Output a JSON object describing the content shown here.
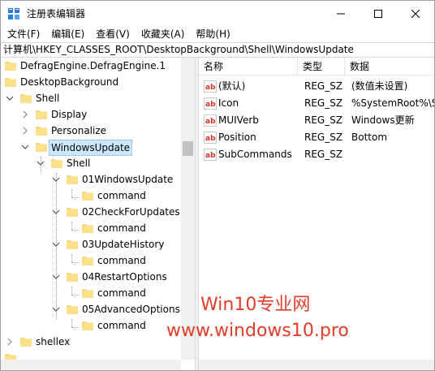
{
  "window": {
    "title": "注册表编辑器",
    "icon": "regedit-icon"
  },
  "menu": [
    "文件(F)",
    "编辑(E)",
    "查看(V)",
    "收藏夹(A)",
    "帮助(H)"
  ],
  "address": "计算机\\HKEY_CLASSES_ROOT\\DesktopBackground\\Shell\\WindowsUpdate",
  "tree": [
    {
      "label": "DefragEngine.DefragEngine.1"
    },
    {
      "label": "DesktopBackground"
    },
    {
      "label": "Shell"
    },
    {
      "label": "Display"
    },
    {
      "label": "Personalize"
    },
    {
      "label": "WindowsUpdate",
      "selected": true
    },
    {
      "label": "Shell"
    },
    {
      "label": "01WindowsUpdate"
    },
    {
      "label": "command"
    },
    {
      "label": "02CheckForUpdates"
    },
    {
      "label": "command"
    },
    {
      "label": "03UpdateHistory"
    },
    {
      "label": "command"
    },
    {
      "label": "04RestartOptions"
    },
    {
      "label": "command"
    },
    {
      "label": "05AdvancedOptions"
    },
    {
      "label": "command"
    },
    {
      "label": "shellex"
    }
  ],
  "list": {
    "columns": [
      "名称",
      "类型",
      "数据"
    ],
    "rows": [
      {
        "name": "(默认)",
        "type": "REG_SZ",
        "data": "(数值未设置)"
      },
      {
        "name": "Icon",
        "type": "REG_SZ",
        "data": "%SystemRoot%\\S"
      },
      {
        "name": "MUIVerb",
        "type": "REG_SZ",
        "data": "Windows更新"
      },
      {
        "name": "Position",
        "type": "REG_SZ",
        "data": "Bottom"
      },
      {
        "name": "SubCommands",
        "type": "REG_SZ",
        "data": ""
      }
    ]
  },
  "watermark": {
    "line1": "Win10专业网",
    "line2": "www.windows10.pro",
    "color": "#e23c2a"
  }
}
